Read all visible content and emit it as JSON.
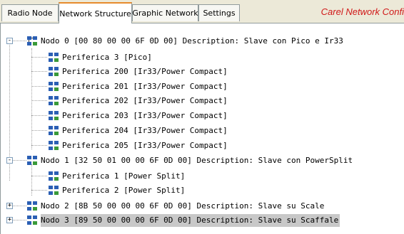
{
  "tabs": [
    {
      "label": "Radio Node"
    },
    {
      "label": "Network Structure"
    },
    {
      "label": "Graphic Network"
    },
    {
      "label": "Settings"
    }
  ],
  "brand": "Carel Network Confi",
  "tree": {
    "nodes": [
      {
        "label": "Nodo 0 [00 80 00 00 6F 0D 00] Description: Slave con Pico e Ir33",
        "expanded": "-",
        "children": [
          "Periferica 3 [Pico]",
          "Periferica 200 [Ir33/Power Compact]",
          "Periferica 201 [Ir33/Power Compact]",
          "Periferica 202 [Ir33/Power Compact]",
          "Periferica 203 [Ir33/Power Compact]",
          "Periferica 204 [Ir33/Power Compact]",
          "Periferica 205 [Ir33/Power Compact]"
        ]
      },
      {
        "label": "Nodo 1 [32 50 01 00 00 6F 0D 00] Description: Slave con PowerSplit",
        "expanded": "-",
        "children": [
          "Periferica 1 [Power Split]",
          "Periferica 2 [Power Split]"
        ]
      },
      {
        "label": "Nodo 2 [8B 50 00 00 00 6F 0D 00] Description: Slave su Scale",
        "expanded": "+",
        "children": []
      },
      {
        "label": "Nodo 3 [89 50 00 00 00 6F 0D 00] Description: Slave su Scaffale",
        "expanded": "+",
        "children": []
      }
    ]
  }
}
